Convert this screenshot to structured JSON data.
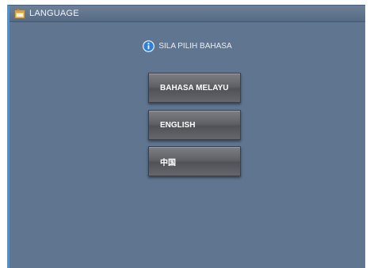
{
  "window": {
    "title": "LANGUAGE",
    "icon": "window-app-icon"
  },
  "prompt": {
    "icon": "info-icon",
    "text": "SILA PILIH BAHASA"
  },
  "languages": [
    {
      "label": "BAHASA MELAYU"
    },
    {
      "label": "ENGLISH"
    },
    {
      "label": "中国"
    }
  ],
  "colors": {
    "window_background": "#5f7590",
    "left_accent": "#3f95e6",
    "button_face": "#606267",
    "text": "#ffffff"
  }
}
